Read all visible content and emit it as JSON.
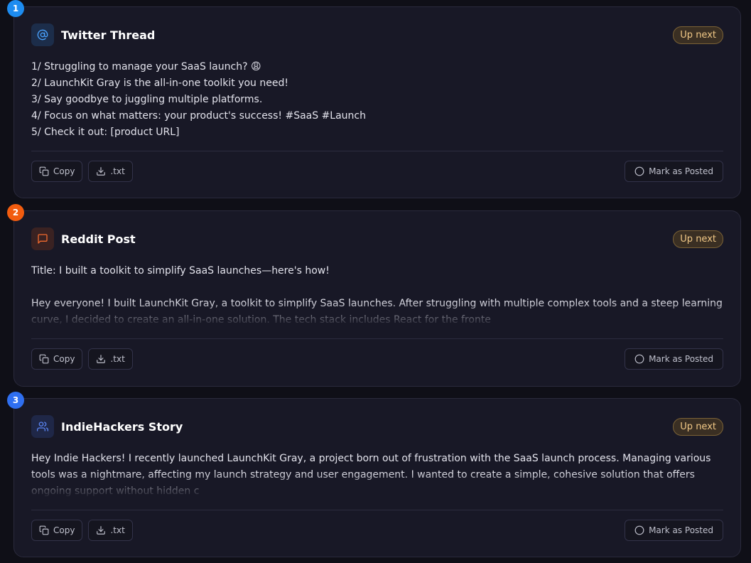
{
  "cards": [
    {
      "number": "1",
      "title": "Twitter Thread",
      "icon": "at-icon",
      "badge": "Up next",
      "content": "1/ Struggling to manage your SaaS launch? 😩\n2/ LaunchKit Gray is the all-in-one toolkit you need!\n3/ Say goodbye to juggling multiple platforms.\n4/ Focus on what matters: your product's success! #SaaS #Launch\n5/ Check it out: [product URL]",
      "copy_label": "Copy",
      "download_label": ".txt",
      "posted_label": "Mark as Posted"
    },
    {
      "number": "2",
      "title": "Reddit Post",
      "icon": "message-square-icon",
      "badge": "Up next",
      "content": "Title: I built a toolkit to simplify SaaS launches—here's how!\n\nHey everyone! I built LaunchKit Gray, a toolkit to simplify SaaS launches. After struggling with multiple complex tools and a steep learning curve, I decided to create an all-in-one solution. The tech stack includes React for the fronte",
      "copy_label": "Copy",
      "download_label": ".txt",
      "posted_label": "Mark as Posted"
    },
    {
      "number": "3",
      "title": "IndieHackers Story",
      "icon": "users-icon",
      "badge": "Up next",
      "content": "Hey Indie Hackers! I recently launched LaunchKit Gray, a project born out of frustration with the SaaS launch process. Managing various tools was a nightmare, affecting my launch strategy and user engagement. I wanted to create a simple, cohesive solution that offers ongoing support without hidden c",
      "copy_label": "Copy",
      "download_label": ".txt",
      "posted_label": "Mark as Posted"
    }
  ],
  "colors": {
    "number_1": "#1d8cf0",
    "number_2": "#f25c0f",
    "number_3": "#2f6ff0",
    "twitter_icon_bg": "#1c2d4a",
    "twitter_icon_fg": "#4aa3ff",
    "reddit_icon_bg": "#3a2222",
    "reddit_icon_fg": "#f26a2e",
    "indie_icon_bg": "#1f2747",
    "indie_icon_fg": "#5b86f5",
    "badge_text": "#f2c987"
  }
}
